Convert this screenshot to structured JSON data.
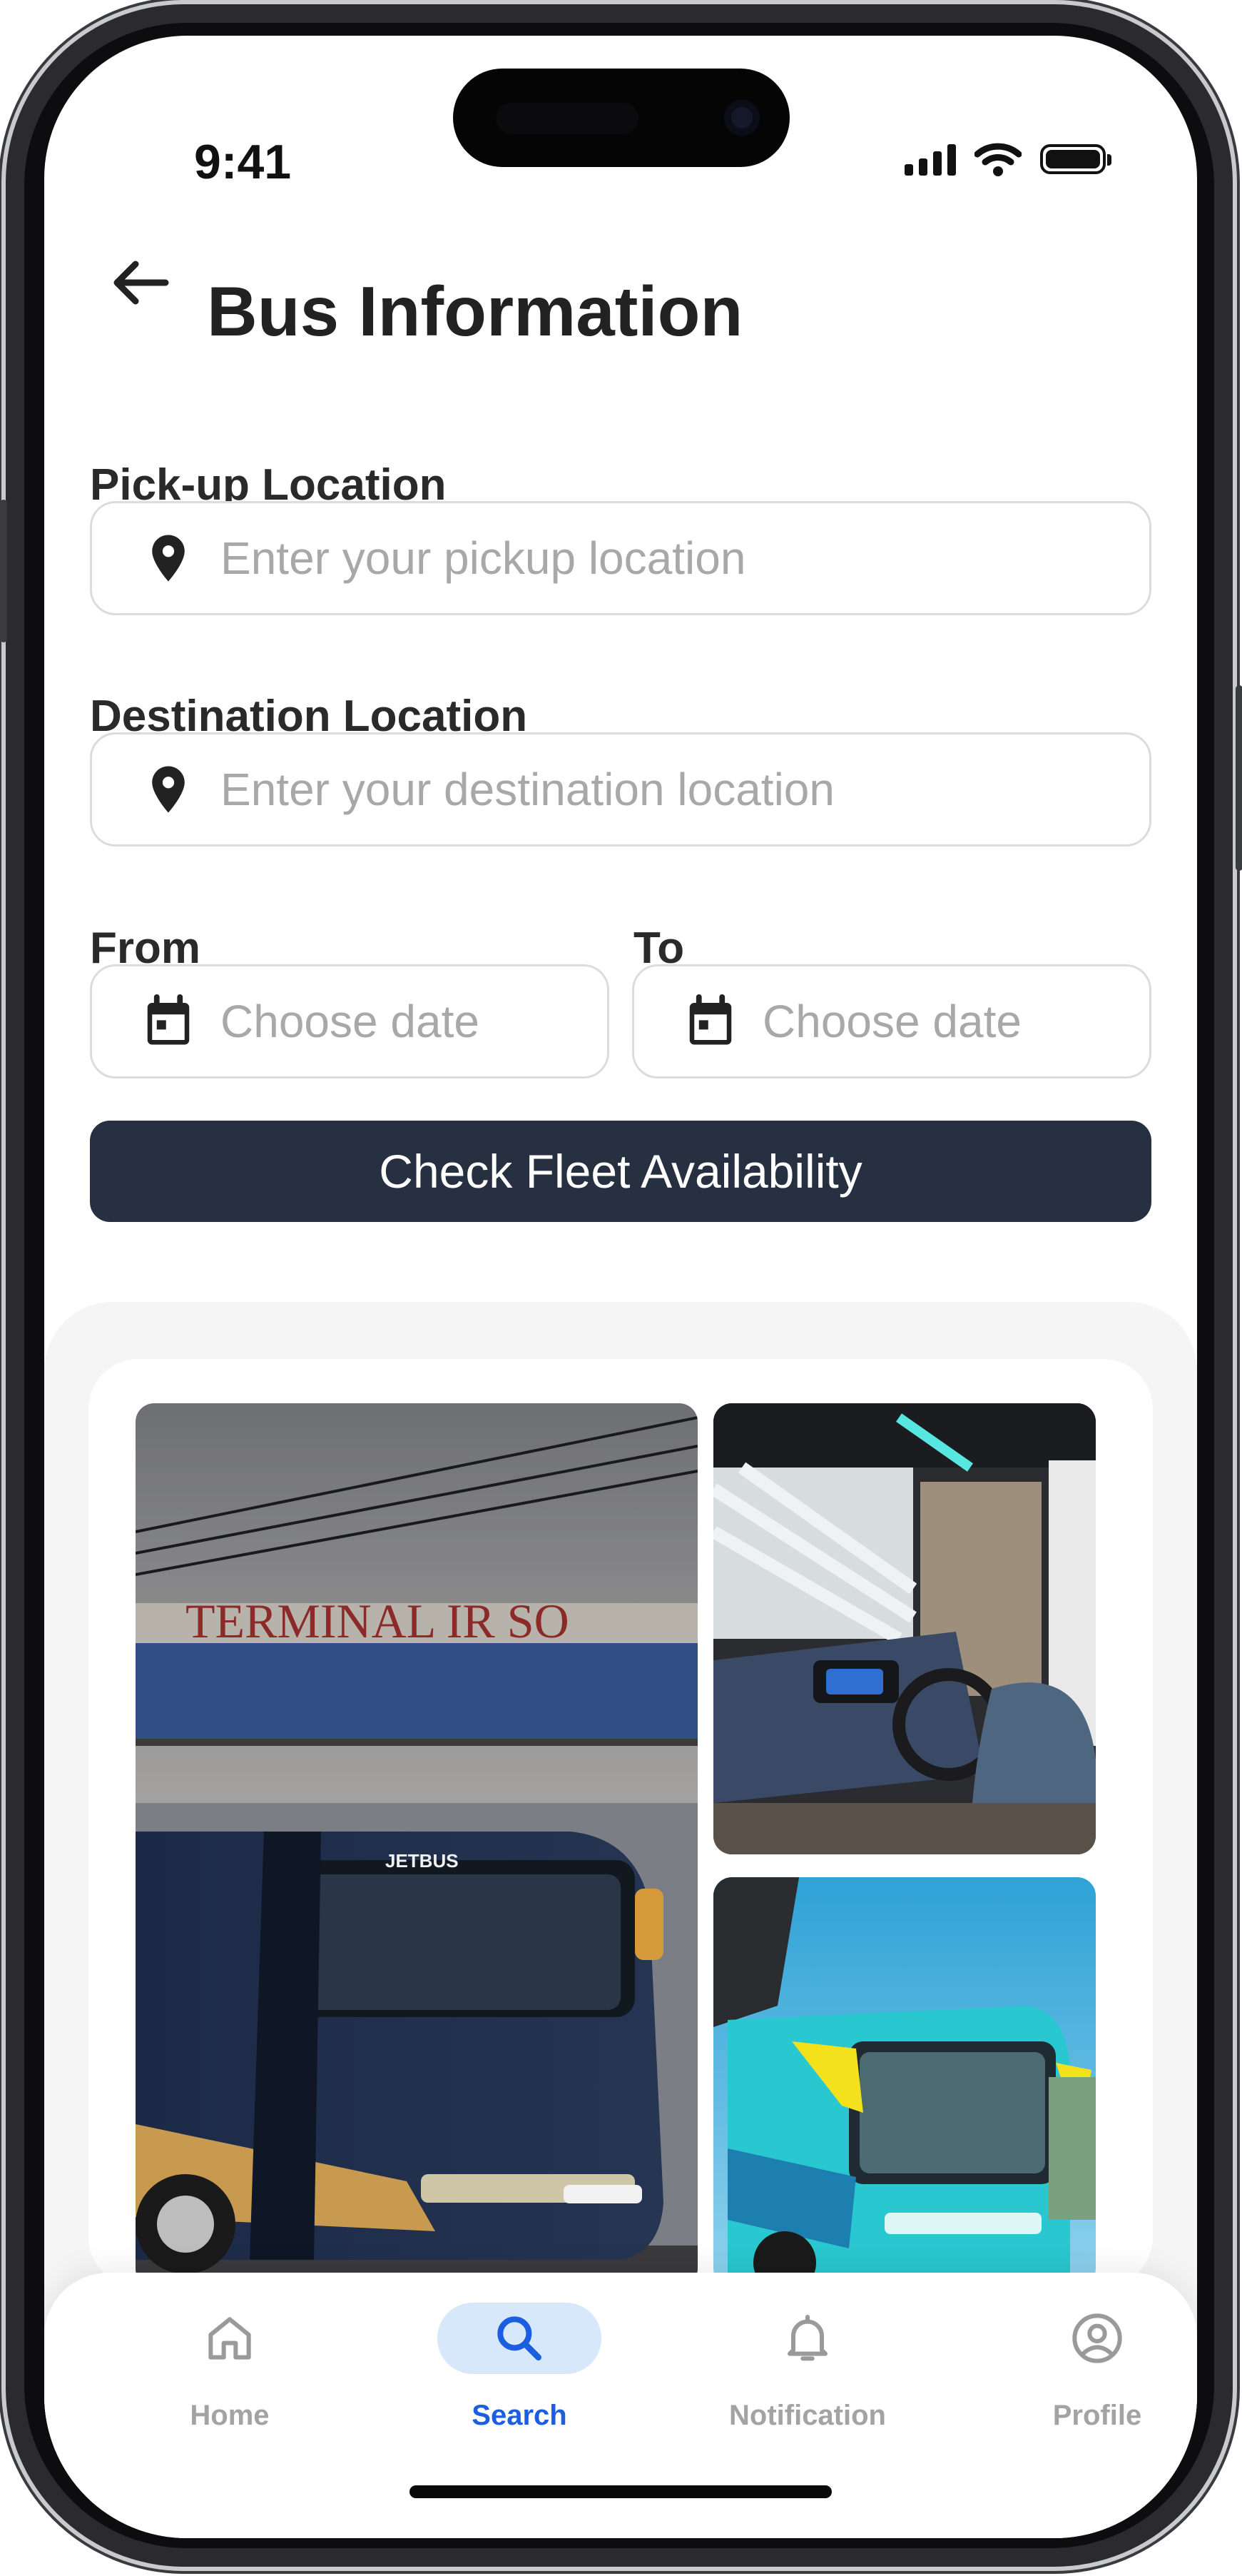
{
  "status_bar": {
    "time": "9:41"
  },
  "header": {
    "title": "Bus Information"
  },
  "form": {
    "pickup": {
      "label": "Pick-up Location",
      "placeholder": "Enter your pickup location"
    },
    "destination": {
      "label": "Destination Location",
      "placeholder": "Enter your destination location"
    },
    "from": {
      "label": "From",
      "placeholder": "Choose date"
    },
    "to": {
      "label": "To",
      "placeholder": "Choose date"
    },
    "submit_label": "Check Fleet Availability"
  },
  "gallery": {
    "photos": [
      "bus-terminal-photo",
      "bus-interior-photo",
      "bus-exterior-photo"
    ]
  },
  "bottom_nav": {
    "items": [
      {
        "label": "Home",
        "icon": "home-icon",
        "active": false
      },
      {
        "label": "Search",
        "icon": "search-icon",
        "active": true
      },
      {
        "label": "Notification",
        "icon": "bell-icon",
        "active": false
      },
      {
        "label": "Profile",
        "icon": "profile-icon",
        "active": false
      }
    ]
  },
  "colors": {
    "primary_button": "#273041",
    "active_nav": "#1b5fe0",
    "active_nav_pill": "#d7e8fb",
    "inactive_nav": "#a3a3a3"
  }
}
